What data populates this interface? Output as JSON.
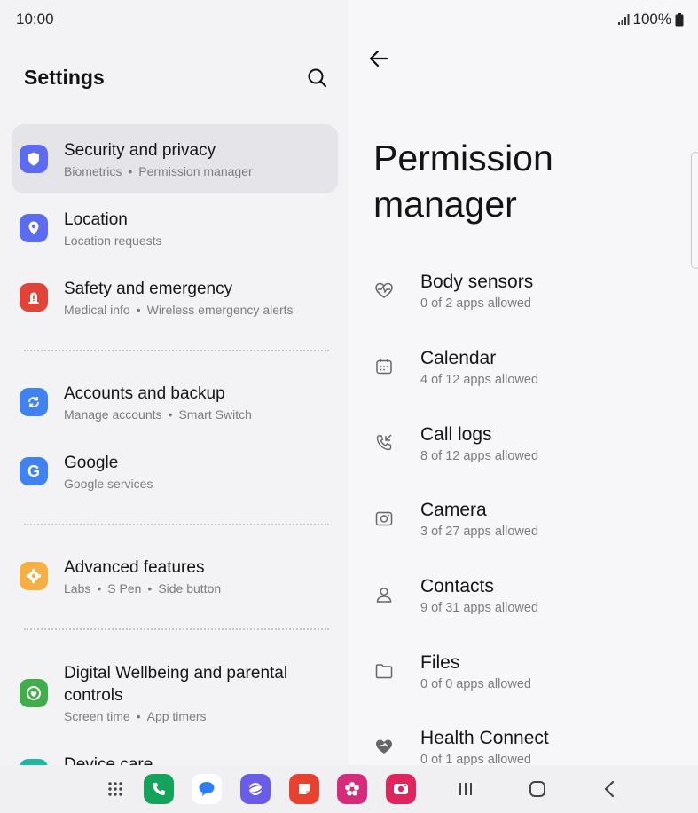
{
  "status": {
    "time": "10:00",
    "battery": "100%"
  },
  "left": {
    "title": "Settings",
    "items": [
      {
        "title": "Security and privacy",
        "sub1": "Biometrics",
        "sub2": "Permission manager",
        "icon": "shield-icon",
        "color": "#5b6cf0"
      },
      {
        "title": "Location",
        "sub1": "Location requests",
        "icon": "location-pin-icon",
        "color": "#5b6cf0"
      },
      {
        "title": "Safety and emergency",
        "sub1": "Medical info",
        "sub2": "Wireless emergency alerts",
        "icon": "emergency-icon",
        "color": "#e04438"
      },
      {
        "title": "Accounts and backup",
        "sub1": "Manage accounts",
        "sub2": "Smart Switch",
        "icon": "sync-icon",
        "color": "#3f82f0"
      },
      {
        "title": "Google",
        "sub1": "Google services",
        "icon": "google-icon",
        "color": "#3f82f0"
      },
      {
        "title": "Advanced features",
        "sub1": "Labs",
        "sub2": "S Pen",
        "sub3": "Side button",
        "icon": "gear-flower-icon",
        "color": "#f5b041"
      },
      {
        "title": "Digital Wellbeing and parental controls",
        "sub1": "Screen time",
        "sub2": "App timers",
        "icon": "wellbeing-icon",
        "color": "#3fae4a"
      },
      {
        "title": "Device care",
        "icon": "device-care-icon",
        "color": "#20b8a0"
      }
    ]
  },
  "right": {
    "title": "Permission manager",
    "items": [
      {
        "name": "Body sensors",
        "count": "0 of 2 apps allowed",
        "icon": "heart-pulse-icon"
      },
      {
        "name": "Calendar",
        "count": "4 of 12 apps allowed",
        "icon": "calendar-icon"
      },
      {
        "name": "Call logs",
        "count": "8 of 12 apps allowed",
        "icon": "call-log-icon"
      },
      {
        "name": "Camera",
        "count": "3 of 27 apps allowed",
        "icon": "camera-icon"
      },
      {
        "name": "Contacts",
        "count": "9 of 31 apps allowed",
        "icon": "contact-icon"
      },
      {
        "name": "Files",
        "count": "0 of 0 apps allowed",
        "icon": "folder-icon"
      },
      {
        "name": "Health Connect",
        "count": "0 of 1 apps allowed",
        "icon": "health-connect-icon"
      }
    ]
  },
  "dock": {
    "apps": [
      {
        "name": "grid-apps-icon"
      },
      {
        "name": "phone-app-icon",
        "color": "#14a35a"
      },
      {
        "name": "messages-app-icon",
        "color": "#2d7ff9"
      },
      {
        "name": "internet-app-icon",
        "color": "#6a5ce8"
      },
      {
        "name": "notes-app-icon",
        "color": "#e8412f"
      },
      {
        "name": "gallery-app-icon",
        "color": "#d62a7b"
      },
      {
        "name": "camera-app-icon",
        "color": "#e0245e"
      }
    ]
  }
}
